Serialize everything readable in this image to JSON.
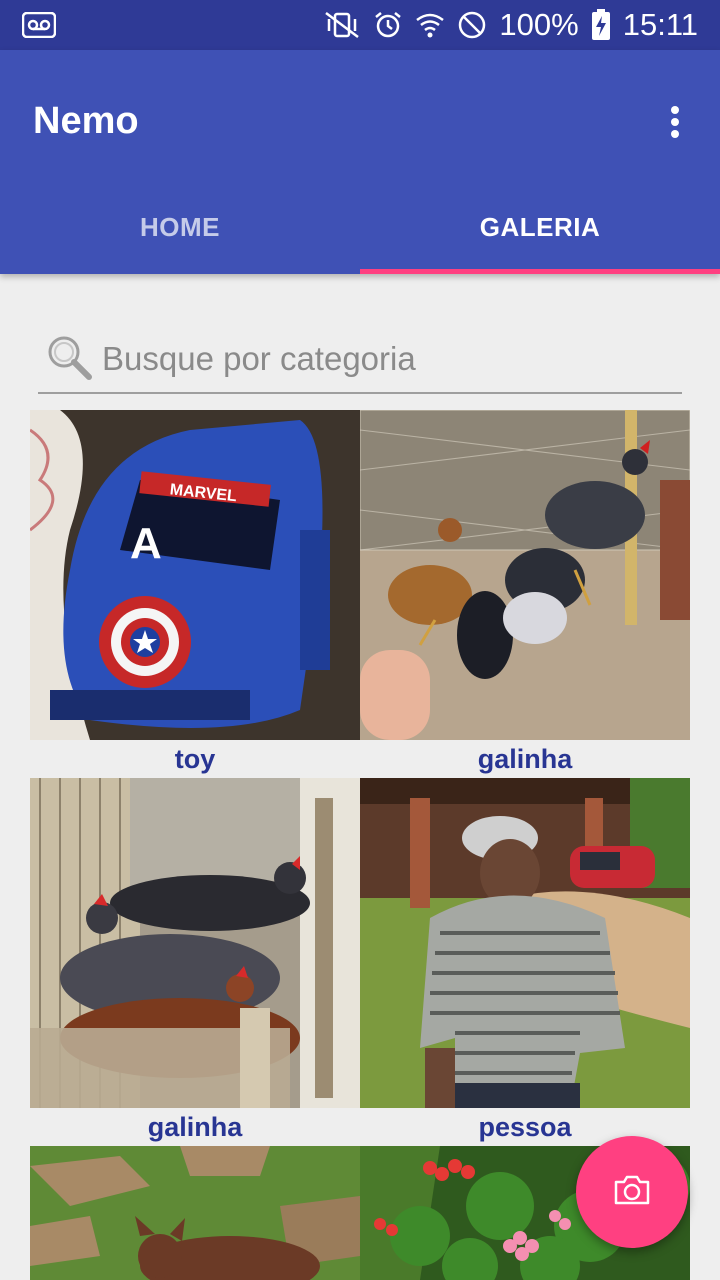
{
  "status_bar": {
    "left_icon": "voicemail-icon",
    "right_icons": [
      "vibrate-mute-icon",
      "alarm-icon",
      "wifi-icon",
      "do-not-disturb-icon"
    ],
    "battery_text": "100%",
    "battery_icon": "battery-charging-icon",
    "time": "15:11"
  },
  "app_bar": {
    "title": "Nemo",
    "menu_icon": "overflow-menu-icon",
    "color": "#3f51b5"
  },
  "tabs": [
    {
      "label": "HOME",
      "active": false
    },
    {
      "label": "GALERIA",
      "active": true
    }
  ],
  "search": {
    "icon": "search-icon",
    "placeholder": "Busque por categoria",
    "value": ""
  },
  "gallery": [
    {
      "label": "toy",
      "photo": "toy-car-photo"
    },
    {
      "label": "galinha",
      "photo": "chickens-photo"
    },
    {
      "label": "galinha",
      "photo": "hens-nest-photo"
    },
    {
      "label": "pessoa",
      "photo": "person-photo"
    },
    {
      "label": "",
      "photo": "dog-photo"
    },
    {
      "label": "",
      "photo": "flowers-photo"
    }
  ],
  "fab": {
    "icon": "camera-icon",
    "color": "#ff4081"
  },
  "colors": {
    "status_bar": "#2f3a96",
    "accent": "#ff4081",
    "caption": "#283593"
  }
}
